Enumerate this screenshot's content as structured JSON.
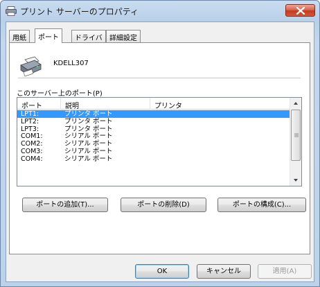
{
  "window": {
    "title": "プリント サーバーのプロパティ",
    "close_icon": "close-icon"
  },
  "tabs": [
    {
      "label": "用紙",
      "active": false
    },
    {
      "label": "ポート",
      "active": true
    },
    {
      "label": "ドライバ",
      "active": false
    },
    {
      "label": "詳細設定",
      "active": false
    }
  ],
  "server": {
    "icon": "printer-icon",
    "name": "KDELL307"
  },
  "ports_section": {
    "label": "このサーバー上のポート(P)"
  },
  "ports_table": {
    "columns": [
      "ポート",
      "説明",
      "プリンタ"
    ],
    "rows": [
      {
        "port": "LPT1:",
        "description": "プリンタ ポート",
        "printer": "",
        "selected": true
      },
      {
        "port": "LPT2:",
        "description": "プリンタ ポート",
        "printer": "",
        "selected": false
      },
      {
        "port": "LPT3:",
        "description": "プリンタ ポート",
        "printer": "",
        "selected": false
      },
      {
        "port": "COM1:",
        "description": "シリアル ポート",
        "printer": "",
        "selected": false
      },
      {
        "port": "COM2:",
        "description": "シリアル ポート",
        "printer": "",
        "selected": false
      },
      {
        "port": "COM3:",
        "description": "シリアル ポート",
        "printer": "",
        "selected": false
      },
      {
        "port": "COM4:",
        "description": "シリアル ポート",
        "printer": "",
        "selected": false
      }
    ]
  },
  "port_buttons": {
    "add": "ポートの追加(T)...",
    "delete": "ポートの削除(D)",
    "configure": "ポートの構成(C)..."
  },
  "dialog_buttons": {
    "ok": "OK",
    "cancel": "キャンセル",
    "apply": "適用(A)"
  },
  "colors": {
    "selection": "#3399ff",
    "close_button": "#c33b1e"
  }
}
